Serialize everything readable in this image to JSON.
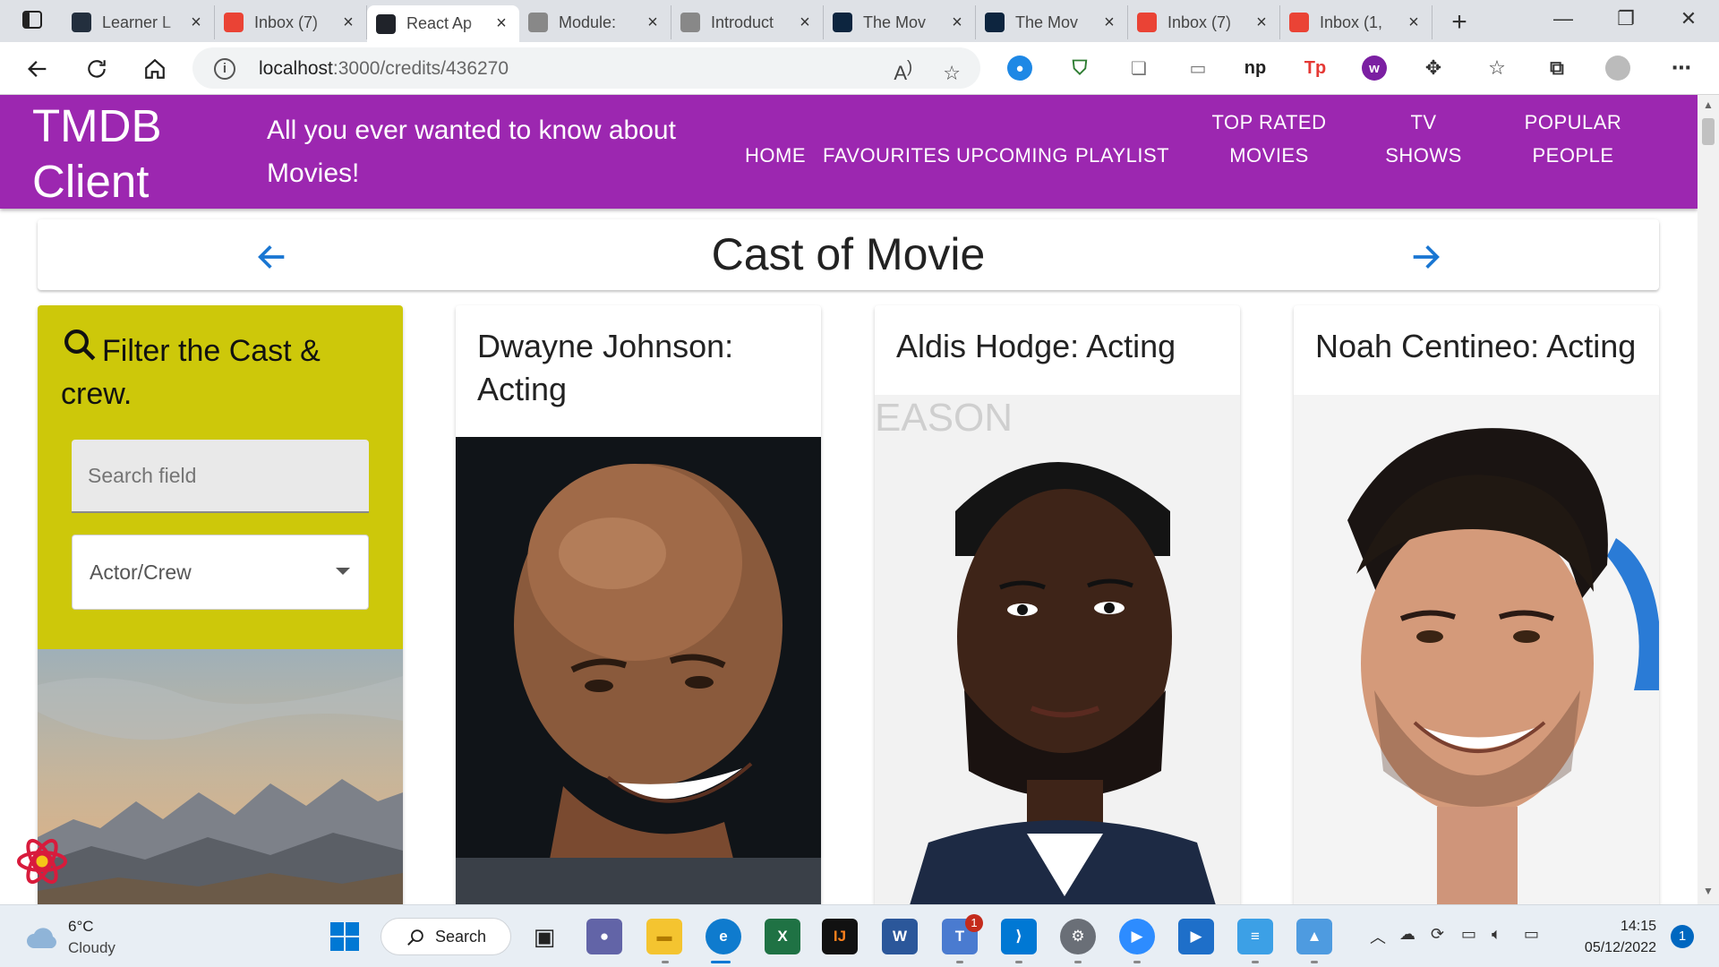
{
  "browser": {
    "tabs": [
      {
        "title": "Learner L",
        "icon": "aws-icon",
        "color": "#232f3e"
      },
      {
        "title": "Inbox (7)",
        "icon": "gmail-icon",
        "color": "#ea4335"
      },
      {
        "title": "React Ap",
        "icon": "react-icon",
        "color": "#20232a",
        "active": true
      },
      {
        "title": "Module:",
        "icon": "document-icon",
        "color": "#888888"
      },
      {
        "title": "Introduct",
        "icon": "book-icon",
        "color": "#888888"
      },
      {
        "title": "The Mov",
        "icon": "tmdb-icon",
        "color": "#0d253f"
      },
      {
        "title": "The Mov",
        "icon": "tmdb-icon",
        "color": "#0d253f"
      },
      {
        "title": "Inbox (7)",
        "icon": "gmail-icon",
        "color": "#ea4335"
      },
      {
        "title": "Inbox (1,",
        "icon": "gmail-icon",
        "color": "#ea4335"
      }
    ],
    "url_host": "localhost",
    "url_path": ":3000/credits/436270"
  },
  "app": {
    "brand": "TMDB Client",
    "tagline": "All you ever wanted to know about Movies!",
    "nav": {
      "home": "HOME",
      "favourites": "FAVOURITES",
      "upcoming": "UPCOMING",
      "playlist": "PLAYLIST",
      "top_rated_1": "TOP RATED",
      "top_rated_2": "MOVIES",
      "tv_1": "TV",
      "tv_2": "SHOWS",
      "popular_1": "POPULAR",
      "popular_2": "PEOPLE"
    },
    "colors": {
      "appbar": "#9c27b0",
      "filter_card": "#cdc80a",
      "arrow": "#1976d2"
    }
  },
  "page": {
    "title": "Cast of Movie"
  },
  "filter": {
    "title": "Filter the Cast & crew.",
    "search_placeholder": "Search field",
    "select_value": "Actor/Crew"
  },
  "cast": [
    {
      "name": "Dwayne Johnson: Acting"
    },
    {
      "name": "Aldis Hodge: Acting"
    },
    {
      "name": "Noah Centineo: Acting"
    }
  ],
  "taskbar": {
    "weather_temp": "6°C",
    "weather_cond": "Cloudy",
    "search_label": "Search",
    "teams_badge": "1",
    "time": "14:15",
    "date": "05/12/2022",
    "notifications": "1"
  }
}
